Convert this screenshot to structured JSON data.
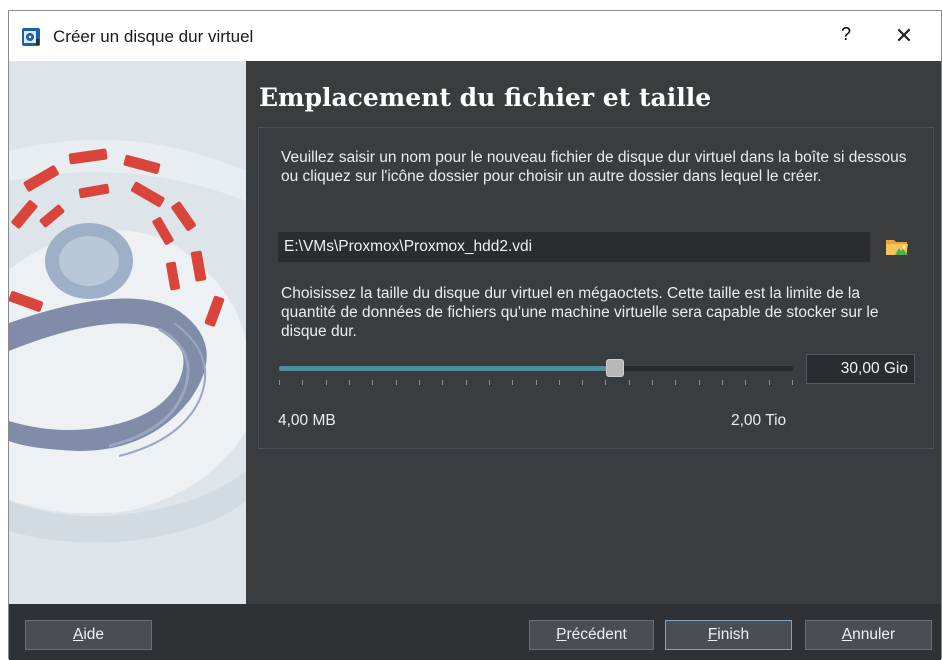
{
  "window": {
    "title": "Créer un disque dur virtuel",
    "help_glyph": "?",
    "close_glyph": "✕"
  },
  "page": {
    "heading": "Emplacement du fichier et taille",
    "location_description": "Veuillez saisir un nom pour le nouveau fichier de disque dur virtuel dans la boîte si dessous ou cliquez sur l'icône dossier pour choisir un autre dossier dans lequel le créer.",
    "file_path": "E:\\VMs\\Proxmox\\Proxmox_hdd2.vdi",
    "size_description": "Choisissez la taille du disque dur virtuel en mégaoctets. Cette taille est la limite de la quantité de données de fichiers qu'une machine virtuelle sera capable de stocker sur le disque dur.",
    "size_value": "30,00 Gio",
    "slider_fraction": 0.66,
    "min_label": "4,00 MB",
    "max_label": "2,00 Tio"
  },
  "buttons": {
    "help": {
      "mnemonic": "A",
      "rest": "ide"
    },
    "previous": {
      "mnemonic": "P",
      "rest": "récédent"
    },
    "finish": {
      "mnemonic": "F",
      "rest": "inish"
    },
    "cancel": {
      "mnemonic": "A",
      "rest": "nnuler"
    }
  },
  "colors": {
    "accent": "#4f8d9c",
    "background": "#3a3d40",
    "disk_red": "#d9453a"
  },
  "icons": {
    "app": "virtualbox-disk-icon",
    "folder": "folder-open-icon"
  }
}
